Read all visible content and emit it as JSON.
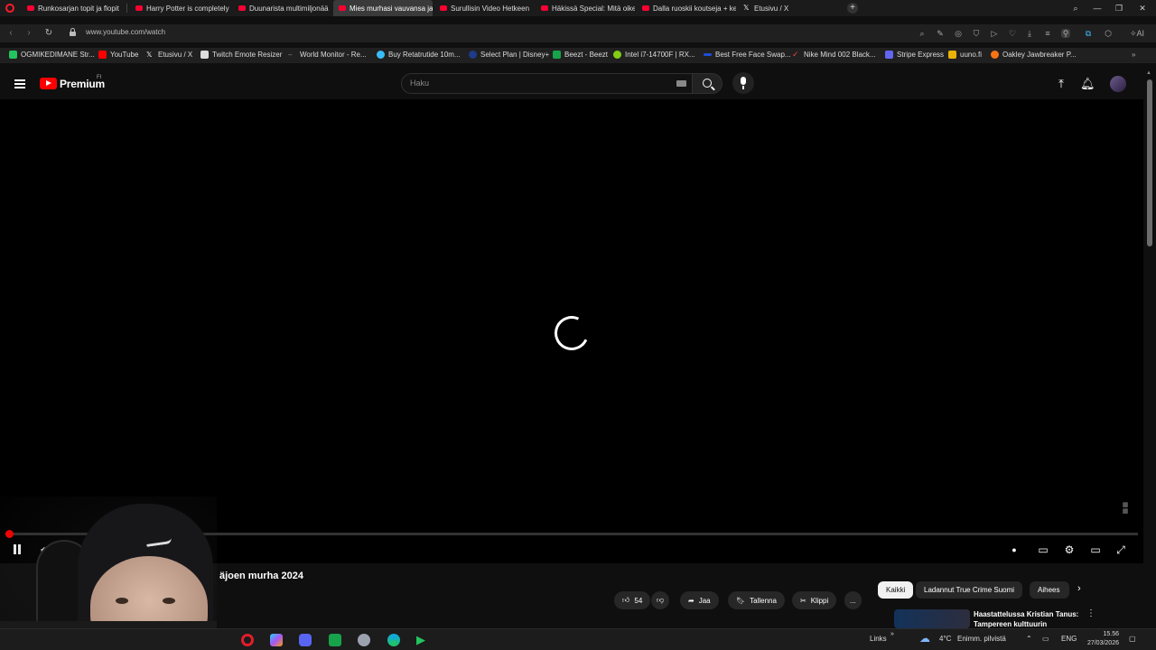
{
  "browser": {
    "tabs": [
      {
        "label": "Runkosarjan topit ja flopit"
      },
      {
        "label": "Harry Potter is completely"
      },
      {
        "label": "Duunarista multimiljonää"
      },
      {
        "label": "Mies murhasi vauvansa ja"
      },
      {
        "label": "Surullisin Video Hetkeen"
      },
      {
        "label": "Häkissä Special: Mitä oike"
      },
      {
        "label": "Dalla ruoskii koutseja + ke"
      },
      {
        "label": "Etusivu / X"
      }
    ],
    "new_tab": "+",
    "address": "www.youtube.com/watch",
    "bookmarks": [
      {
        "label": "OGMIKEDIMANE Str...",
        "color": "#22c55e"
      },
      {
        "label": "YouTube",
        "color": "#ff0000"
      },
      {
        "label": "Etusivu / X",
        "color": "#ffffff"
      },
      {
        "label": "Twitch Emote Resizer",
        "color": "#dddddd"
      },
      {
        "label": "World Monitor - Re...",
        "color": "#888888"
      },
      {
        "label": "Buy Retatrutide 10m...",
        "color": "#38bdf8"
      },
      {
        "label": "Select Plan | Disney+",
        "color": "#1e3a8a"
      },
      {
        "label": "Beezt - Beezt",
        "color": "#16a34a"
      },
      {
        "label": "Intel i7-14700F | RX...",
        "color": "#84cc16"
      },
      {
        "label": "Best Free Face Swap...",
        "color": "#1d4ed8"
      },
      {
        "label": "Nike Mind 002 Black...",
        "color": "#ef4444"
      },
      {
        "label": "Stripe Express",
        "color": "#6366f1"
      },
      {
        "label": "uuno.fi",
        "color": "#eab308"
      },
      {
        "label": "Oakley Jawbreaker P...",
        "color": "#f97316"
      }
    ]
  },
  "youtube": {
    "brand": "Premium",
    "region": "FI",
    "search_placeholder": "Haku",
    "video_title_partial": "äjoen murha 2024",
    "actions": {
      "likes": "54",
      "share": "Jaa",
      "save": "Tallenna",
      "clip": "Klippi",
      "more": "..."
    },
    "chips": [
      "Kaikki",
      "Ladannut True Crime Suomi",
      "Aihees"
    ],
    "recommendation_title": "Haastattelussa Kristian Tanus: Tampereen kulttuurin"
  },
  "player": {
    "progress_fraction": 0.003
  },
  "taskbar": {
    "links_label": "Links",
    "temperature": "4°C",
    "weather": "Enimm. pilvistä",
    "language": "ENG",
    "time": "15.56",
    "date": "27/03/2026"
  }
}
